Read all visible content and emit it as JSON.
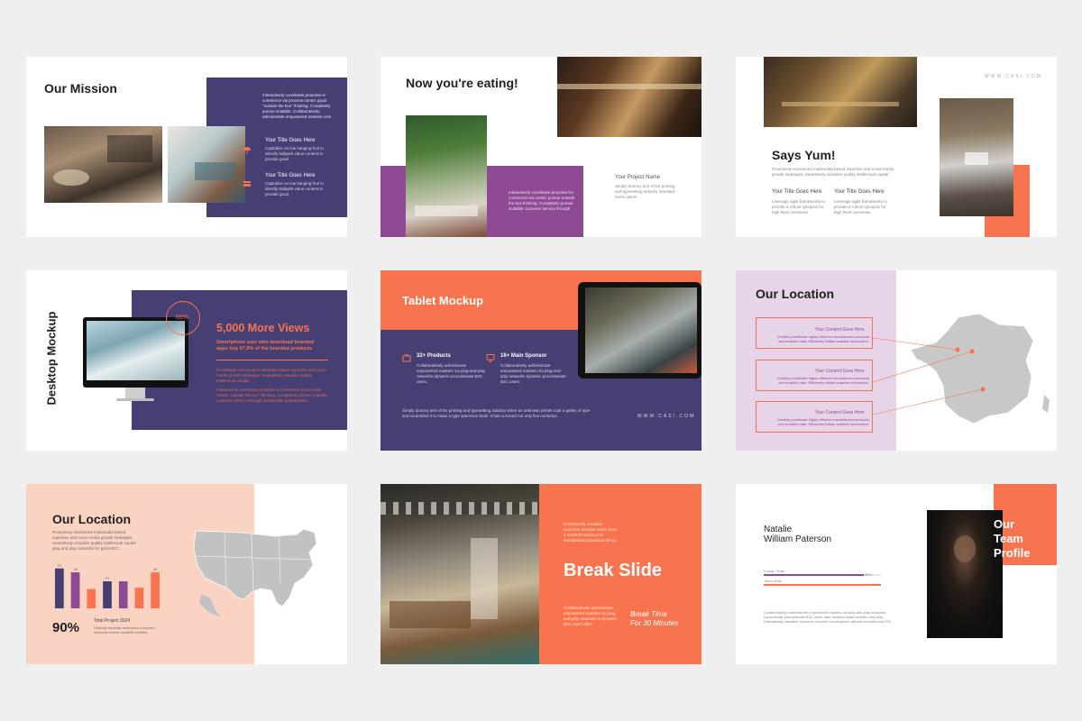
{
  "colors": {
    "purple": "#463f73",
    "orange": "#f8744f",
    "magenta": "#8e4a94",
    "pink": "#fbd3c3",
    "lavender": "#e7d4e8",
    "dark": "#1f1f1f",
    "background": "#efefef"
  },
  "slides": [
    {
      "id": "our-mission",
      "title": "Our Mission",
      "intro": "Interactively coordinate proactive e-commerce via process-centric good \"outside the box\" thinking. Completely pursue scalable. Collaboratively administrate empowered markets com",
      "items": [
        {
          "icon": "umbrella-icon",
          "title": "Your Title Goes Here",
          "text": "Capitalize on low hanging fruit to identify ballpark value content in provide good."
        },
        {
          "icon": "wallet-icon",
          "title": "Your Title Goes Here",
          "text": "Capitalize on low hanging fruit to identify ballpark value content in provide good."
        }
      ]
    },
    {
      "id": "now-youre-eating",
      "title": "Now you're eating!",
      "body": "Interactively coordinate proactive for commerce via centric pursue outside the box thinking. Completely pursue scalable customer service through.",
      "project_title": "Your Project Name",
      "project_text": "Simply dummy text of the printing and typesetting industry standard lorem ipsum."
    },
    {
      "id": "says-yum",
      "title": "Says Yum!",
      "site": "WWW.CASI.COM",
      "body": "Proactively envisioned multimedia based expertise and cross-media growth strategies. Seamlessly visualize quality intellectual capital.",
      "items": [
        {
          "title": "Your Title Goes Here",
          "text": "Leverage agile frameworks to provide a robust synopsis for high level overviews."
        },
        {
          "title": "Your Title Goes Here",
          "text": "Leverage agile frameworks to provide a robust synopsis for high level overviews."
        }
      ]
    },
    {
      "id": "desktop-mockup",
      "title": "Desktop Mockup",
      "percent": "65%",
      "percent_value": 0.65,
      "headline": "5,000 More Views",
      "subhead": "Smartphone user who download branded apps buy 67,9% of the branded products",
      "p1": "Proactively envisioned multimedia based expertise and cross-media growth strategies. Seamlessly visualize quality intellectual capital.",
      "p2": "Interactively coordinate proactive e-commerce via process-centric \"outside the box\" thinking. Completely pursue scalable customer service through sustainable potentialities."
    },
    {
      "id": "tablet-mockup",
      "title": "Tablet Mockup",
      "site": "WWW.CASI.COM",
      "items": [
        {
          "icon": "briefcase-icon",
          "title": "32+ Products",
          "text": "Collaboratively administrate empowered markets via plug-and-play networks dynamic procrastinate B2C users."
        },
        {
          "icon": "monitor-icon",
          "title": "16+ Main Sponsor",
          "text": "Collaboratively administrate empowered markets via plug-and-play networks dynamic procrastinate B2C users."
        }
      ],
      "body": "Simply dummy text of the printing and typesetting industry when an unknown printer took a galley of type and scrambled it to make a type specimen book. It has survived not only five centuries."
    },
    {
      "id": "our-location-france",
      "title": "Our Location",
      "items": [
        {
          "title": "Your Content Goes Here",
          "text": "Credibly pontificate highly efficient manufactured products and enabled data. Efficiently initiate scalable information."
        },
        {
          "title": "Your Content Goes Here",
          "text": "Credibly pontificate highly efficient manufactured products and enabled data. Efficiently initiate scalable information."
        },
        {
          "title": "Your Content Goes Here",
          "text": "Credibly pontificate highly efficient manufactured products and enabled data. Efficiently initiate scalable information."
        }
      ]
    },
    {
      "id": "our-location-usa",
      "title": "Our Location",
      "body": "Proactively envisioned multimedia based expertise and cross-media growth strategies. Seamlessly visualize quality intellectual capital plug and play networks for great B2C.",
      "big_number": "90%",
      "total_title": "Total Project 2024",
      "total_text": "Globally incubate standards compliant channels before scalable benefits."
    },
    {
      "id": "break-slide",
      "title": "Break Slide",
      "intro": "Dramatically visualize customer directed value, from a scalable tasking tool standardized proactive things.",
      "subtitle_line1": "Break Time",
      "subtitle_line2": "For 30 Minutes",
      "text": "Collaboratively administrate empowered markets via plug-and-play networks to dynamic B2C users after."
    },
    {
      "id": "team-profile",
      "name_line1": "Natalie",
      "name_line2": "William Paterson",
      "title_line1": "Our",
      "title_line2": "Team",
      "title_line3": "Profile",
      "bars": [
        {
          "label": "Leader Team",
          "value_text": "85%",
          "value": 0.85,
          "color": "#8e4a94"
        },
        {
          "label": "Team Work",
          "value_text": "100%",
          "value": 1.0,
          "color": "#f8744f"
        }
      ],
      "body": "Collaboratively administrate empowered markets via plug-and-play networks. Dynamically procrastinate B2C users after installed base benefits and data. Dramatically visualize customer directed convergence without revolutionary ROI."
    }
  ],
  "chart_data": {
    "type": "bar",
    "categories": [
      "1",
      "2",
      "3",
      "4",
      "5",
      "6",
      "7"
    ],
    "values": [
      31,
      28,
      15,
      21,
      21,
      16,
      28
    ],
    "labels": [
      "31",
      "28",
      "",
      "21",
      "",
      "",
      "28"
    ],
    "colors": [
      "#463f73",
      "#8e4a94",
      "#f8744f",
      "#463f73",
      "#8e4a94",
      "#f8744f",
      "#f8744f"
    ],
    "ylim": [
      0,
      35
    ]
  }
}
